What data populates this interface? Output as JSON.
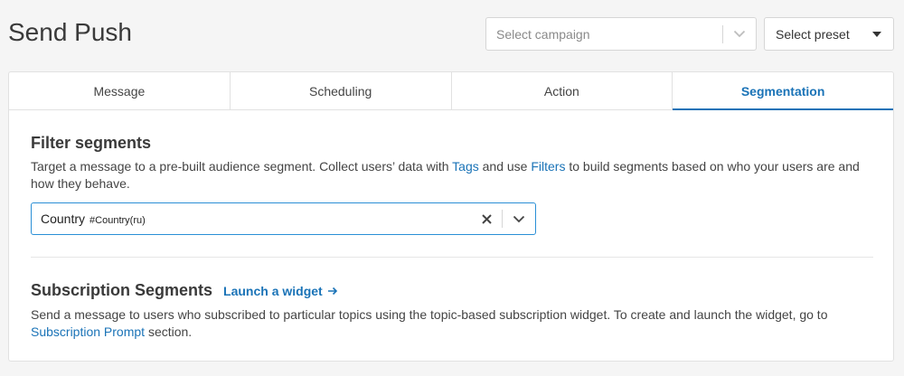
{
  "header": {
    "title": "Send Push",
    "campaign_placeholder": "Select campaign",
    "preset_label": "Select preset"
  },
  "tabs": [
    {
      "label": "Message",
      "active": false
    },
    {
      "label": "Scheduling",
      "active": false
    },
    {
      "label": "Action",
      "active": false
    },
    {
      "label": "Segmentation",
      "active": true
    }
  ],
  "filter": {
    "title": "Filter segments",
    "desc_pre": "Target a message to a pre-built audience segment. Collect users’ data with ",
    "tags_link": "Tags",
    "desc_mid": " and use ",
    "filters_link": "Filters",
    "desc_post": " to build segments based on who your users are and how they behave.",
    "selected_value": "Country",
    "selected_tag": "#Country(ru)"
  },
  "subscription": {
    "title": "Subscription Segments",
    "widget_link": "Launch a widget",
    "desc_pre": "Send a message to users who subscribed to particular topics using the topic-based subscription widget. To create and launch the widget, go to ",
    "prompt_link": "Subscription Prompt",
    "desc_post": " section."
  },
  "icons": {
    "chevron": "chevron-down-icon",
    "caret": "caret-down-icon",
    "clear": "close-icon",
    "arrow": "arrow-right-icon"
  },
  "colors": {
    "accent": "#1a73b7",
    "focus_border": "#2a8fd6",
    "background": "#f5f5f5"
  }
}
